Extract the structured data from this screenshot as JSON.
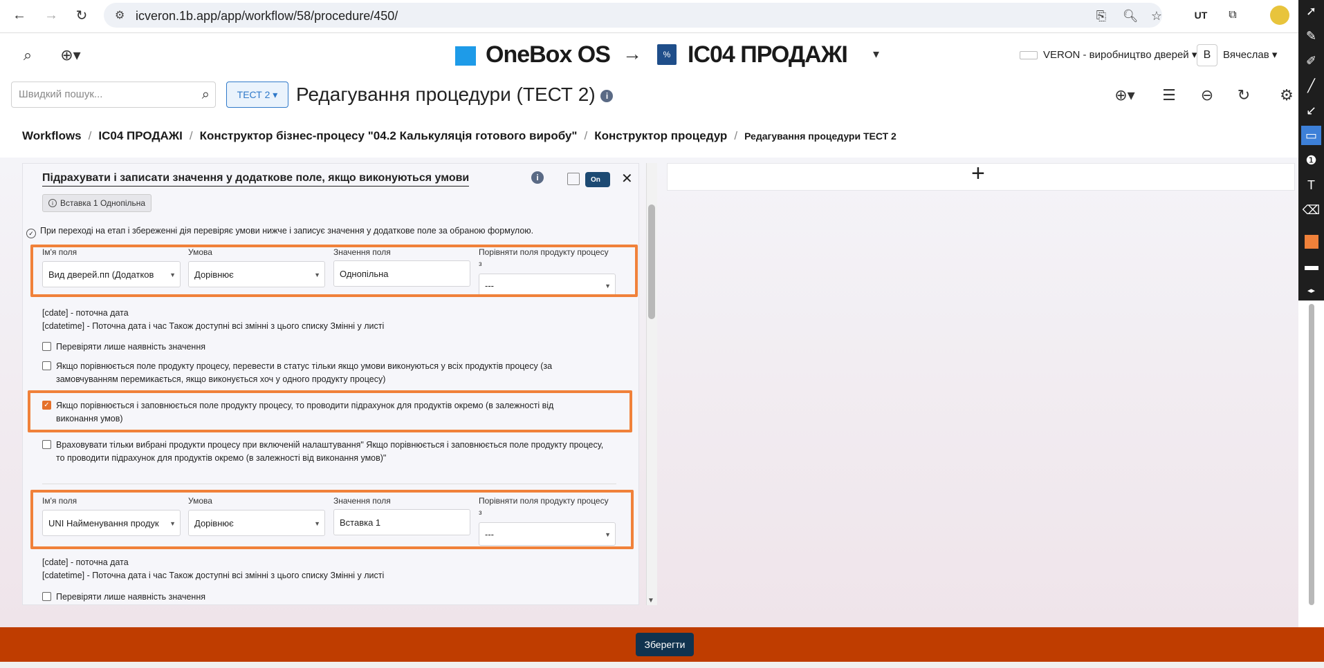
{
  "browser": {
    "url": "icveron.1b.app/app/workflow/58/procedure/450/",
    "ext_ut_label": "UT"
  },
  "header": {
    "app_name": "OneBox OS",
    "arrow": "→",
    "project_name": "ІС04 ПРОДАЖІ",
    "company": "VERON - виробництво дверей",
    "user_initial": "В",
    "user_name": "Вячеслав"
  },
  "toolbar": {
    "search_placeholder": "Швидкий пошук...",
    "test_button": "ТЕСТ 2",
    "page_title": "Редагування процедури (ТЕСТ 2)"
  },
  "breadcrumb": [
    "Workflows",
    "ІС04 ПРОДАЖІ",
    "Конструктор бізнес-процесу \"04.2 Калькуляція готового виробу\"",
    "Конструктор процедур",
    "Редагування процедури ТЕСТ 2"
  ],
  "block": {
    "title": "Підрахувати і записати значення у додаткове поле, якщо виконуються умови",
    "toggle": "On",
    "chip": "Вставка 1 Однопільна",
    "description": "При переході на етап і збереженні дія перевіряє умови нижче і записує значення у додаткове поле за обраною формулою."
  },
  "labels": {
    "field_name": "Ім'я поля",
    "condition": "Умова",
    "field_value": "Значення поля",
    "compare_line1": "Порівняти поля продукту процесу",
    "compare_line2": "з"
  },
  "condition1": {
    "field_name": "Вид дверей.пп (Додатков",
    "condition": "Дорівнює",
    "value": "Однопільна",
    "compare": "---"
  },
  "condition2": {
    "field_name": "UNI Найменування продук",
    "condition": "Дорівнює",
    "value": "Вставка 1",
    "compare": "---"
  },
  "hints": {
    "cdate": "[cdate] - поточна дата",
    "cdatetime": "[cdatetime] - Поточна дата і час Також доступні всі змінні з цього списку Змінні у листі"
  },
  "checkboxes": [
    {
      "label": "Перевіряти лише наявність значення",
      "checked": false
    },
    {
      "label": "Якщо порівнюється поле продукту процесу, перевести в статус тільки якщо умови виконуються у всіх продуктів процесу (за замовчуванням перемикається, якщо виконується хоч у одного продукту процесу)",
      "checked": false
    },
    {
      "label": "Якщо порівнюється і заповнюється поле продукту процесу, то проводити підрахунок для продуктів окремо (в залежності від виконання умов)",
      "checked": true
    },
    {
      "label": "Враховувати тільки вибрані продукти процесу при включеній налаштування\" Якщо порівнюється і заповнюється поле продукту процесу, то проводити підрахунок для продуктів окремо (в залежності від виконання умов)\"",
      "checked": false
    }
  ],
  "checkbox_second": {
    "label": "Перевіряти лише наявність значення",
    "checked": false
  },
  "footer": {
    "save": "Зберегти"
  },
  "colors": {
    "accent_orange": "#f0813a",
    "footer_bg": "#bf3d00",
    "save_bg": "#10334f",
    "toggle_bg": "#1d4a73"
  }
}
